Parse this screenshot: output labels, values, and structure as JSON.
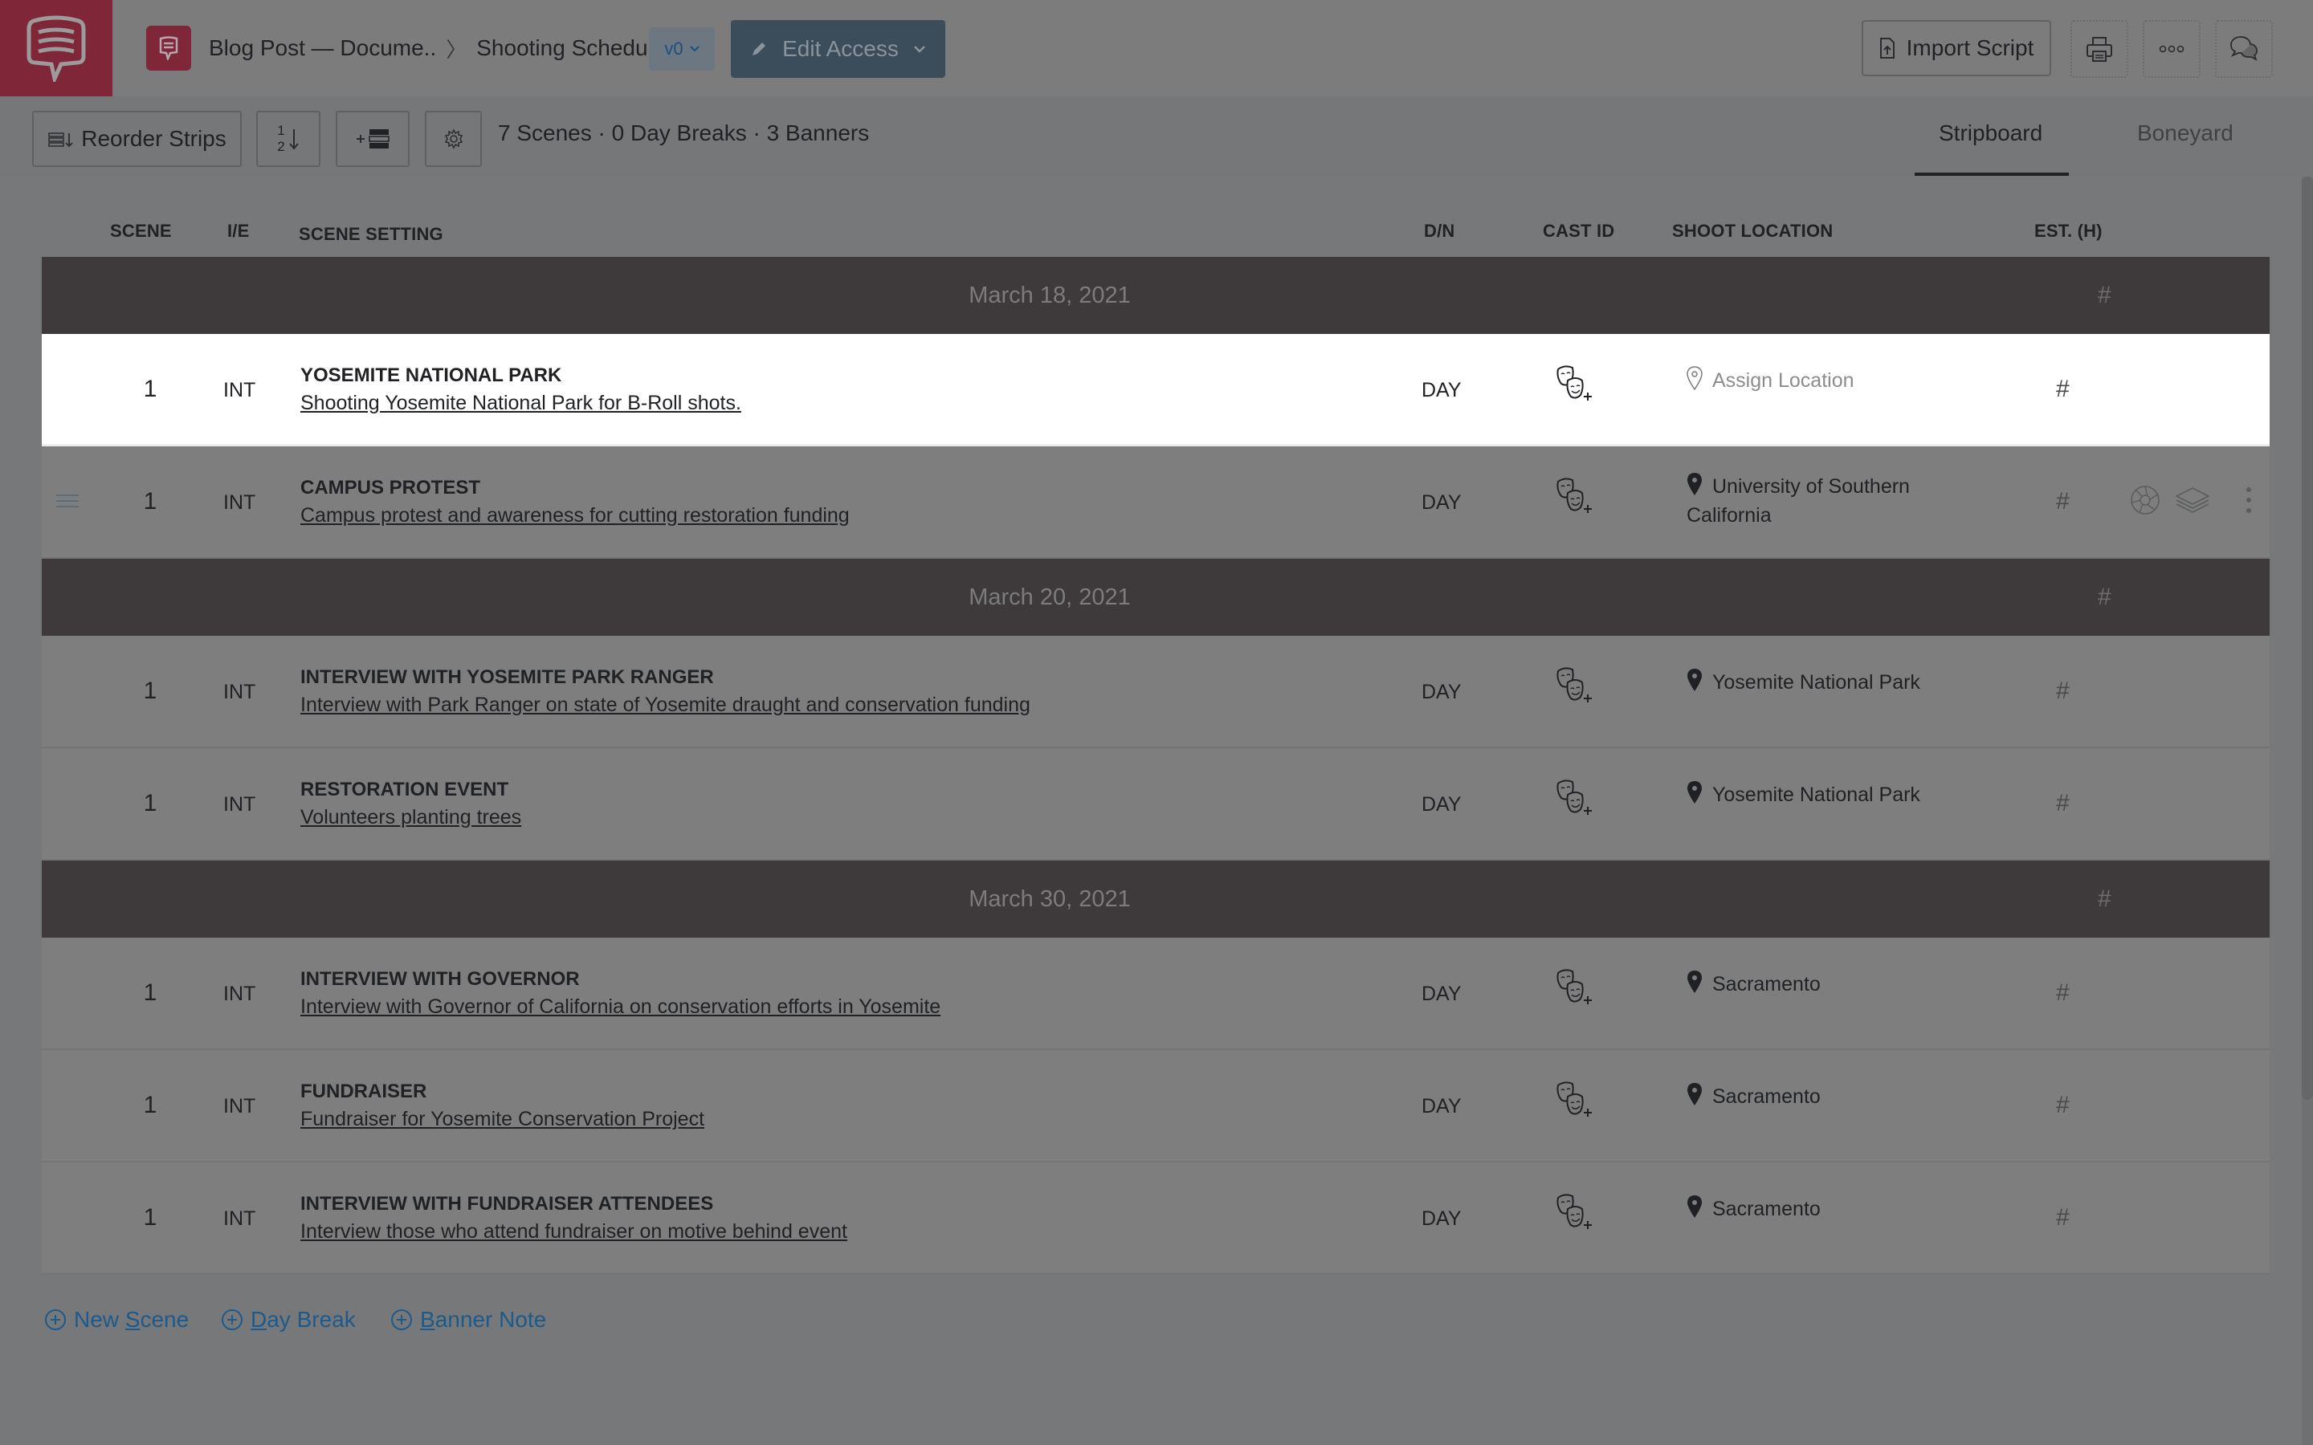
{
  "header": {
    "breadcrumb_project": "Blog Post — Docume..",
    "breadcrumb_separator": ">",
    "breadcrumb_page": "Shooting Schedules",
    "version_label": "v0",
    "edit_access_label": "Edit Access",
    "import_script_label": "Import Script",
    "icons": [
      "studiobinder-logo-icon",
      "document-badge-icon",
      "pencil-icon",
      "chevron-down-icon",
      "file-upload-icon",
      "print-icon",
      "more-horizontal-icon",
      "comments-icon"
    ]
  },
  "toolbar": {
    "reorder_label": "Reorder Strips",
    "sort_icon_top": "1",
    "sort_icon_bottom": "2",
    "summary": "7 Scenes · 0 Day Breaks · 3 Banners",
    "tabs": [
      {
        "label": "Stripboard",
        "active": true
      },
      {
        "label": "Boneyard",
        "active": false
      }
    ]
  },
  "columns": {
    "scene": "SCENE",
    "ie": "I/E",
    "setting": "SCENE SETTING",
    "dn": "D/N",
    "cast": "CAST ID",
    "location": "SHOOT LOCATION",
    "est": "EST. (H)"
  },
  "banners": [
    {
      "date": "March 18, 2021",
      "est": "#"
    },
    {
      "date": "March 20, 2021",
      "est": "#"
    },
    {
      "date": "March 30, 2021",
      "est": "#"
    }
  ],
  "scenes": [
    {
      "number": "1",
      "ie": "INT",
      "title": "YOSEMITE NATIONAL PARK",
      "description": "Shooting Yosemite National Park for B-Roll shots.",
      "dn": "DAY",
      "location": "Assign Location",
      "location_assigned": false,
      "est": "#",
      "selected": true
    },
    {
      "number": "1",
      "ie": "INT",
      "title": "CAMPUS PROTEST",
      "description": "Campus protest and awareness for cutting restoration funding",
      "dn": "DAY",
      "location": "University of Southern California",
      "location_assigned": true,
      "est": "#",
      "hovered": true
    },
    {
      "number": "1",
      "ie": "INT",
      "title": "INTERVIEW WITH YOSEMITE PARK RANGER",
      "description": "Interview with Park Ranger on state of Yosemite draught and conservation funding",
      "dn": "DAY",
      "location": "Yosemite National Park",
      "location_assigned": true,
      "est": "#"
    },
    {
      "number": "1",
      "ie": "INT",
      "title": "RESTORATION EVENT",
      "description": "Volunteers planting trees ",
      "dn": "DAY",
      "location": "Yosemite National Park",
      "location_assigned": true,
      "est": "#"
    },
    {
      "number": "1",
      "ie": "INT",
      "title": "INTERVIEW WITH GOVERNOR",
      "description": "Interview with Governor of California on conservation efforts in Yosemite",
      "dn": "DAY",
      "location": "Sacramento",
      "location_assigned": true,
      "est": "#"
    },
    {
      "number": "1",
      "ie": "INT",
      "title": "FUNDRAISER",
      "description": "Fundraiser for Yosemite Conservation Project",
      "dn": "DAY",
      "location": "Sacramento",
      "location_assigned": true,
      "est": "#"
    },
    {
      "number": "1",
      "ie": "INT",
      "title": "INTERVIEW WITH FUNDRAISER ATTENDEES",
      "description": "Interview those who attend fundraiser on motive behind event",
      "dn": "DAY",
      "location": "Sacramento",
      "location_assigned": true,
      "est": "#"
    }
  ],
  "footer": {
    "new_scene": {
      "pre": "New ",
      "key": "S",
      "post": "cene"
    },
    "day_break": {
      "pre": "",
      "key": "D",
      "post": "ay Break"
    },
    "banner_note": {
      "pre": "",
      "key": "B",
      "post": "anner Note"
    }
  },
  "colors": {
    "brand": "#7f2638",
    "banner_bg": "#3e393a",
    "link": "#1d5a8c",
    "edit_access_bg": "#3b4c5a"
  }
}
